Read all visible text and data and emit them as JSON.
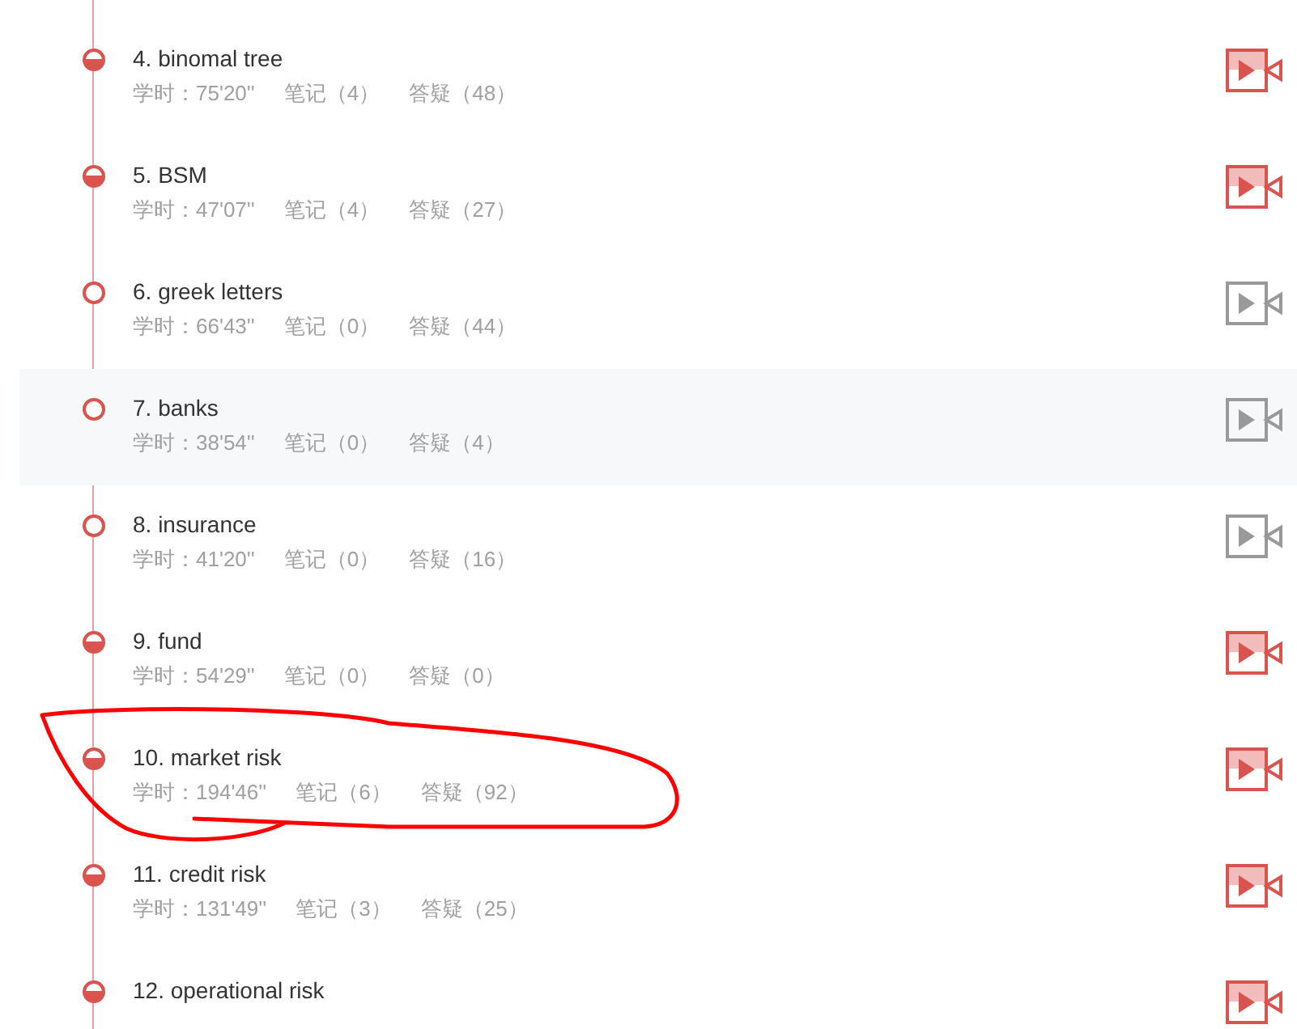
{
  "lessons": [
    {
      "title": "4. binomal tree",
      "study_time": "学时：75'20''",
      "notes": "笔记（4）",
      "qa": "答疑（48）",
      "started": true,
      "highlighted": false
    },
    {
      "title": "5. BSM",
      "study_time": "学时：47'07''",
      "notes": "笔记（4）",
      "qa": "答疑（27）",
      "started": true,
      "highlighted": false
    },
    {
      "title": "6. greek letters",
      "study_time": "学时：66'43''",
      "notes": "笔记（0）",
      "qa": "答疑（44）",
      "started": false,
      "highlighted": false
    },
    {
      "title": "7. banks",
      "study_time": "学时：38'54''",
      "notes": "笔记（0）",
      "qa": "答疑（4）",
      "started": false,
      "highlighted": true
    },
    {
      "title": "8. insurance",
      "study_time": "学时：41'20''",
      "notes": "笔记（0）",
      "qa": "答疑（16）",
      "started": false,
      "highlighted": false
    },
    {
      "title": "9. fund",
      "study_time": "学时：54'29''",
      "notes": "笔记（0）",
      "qa": "答疑（0）",
      "started": true,
      "highlighted": false
    },
    {
      "title": "10. market risk",
      "study_time": "学时：194'46''",
      "notes": "笔记（6）",
      "qa": "答疑（92）",
      "started": true,
      "highlighted": false
    },
    {
      "title": "11. credit risk",
      "study_time": "学时：131'49''",
      "notes": "笔记（3）",
      "qa": "答疑（25）",
      "started": true,
      "highlighted": false
    },
    {
      "title": "12. operational risk",
      "started": true,
      "highlighted": false
    }
  ]
}
